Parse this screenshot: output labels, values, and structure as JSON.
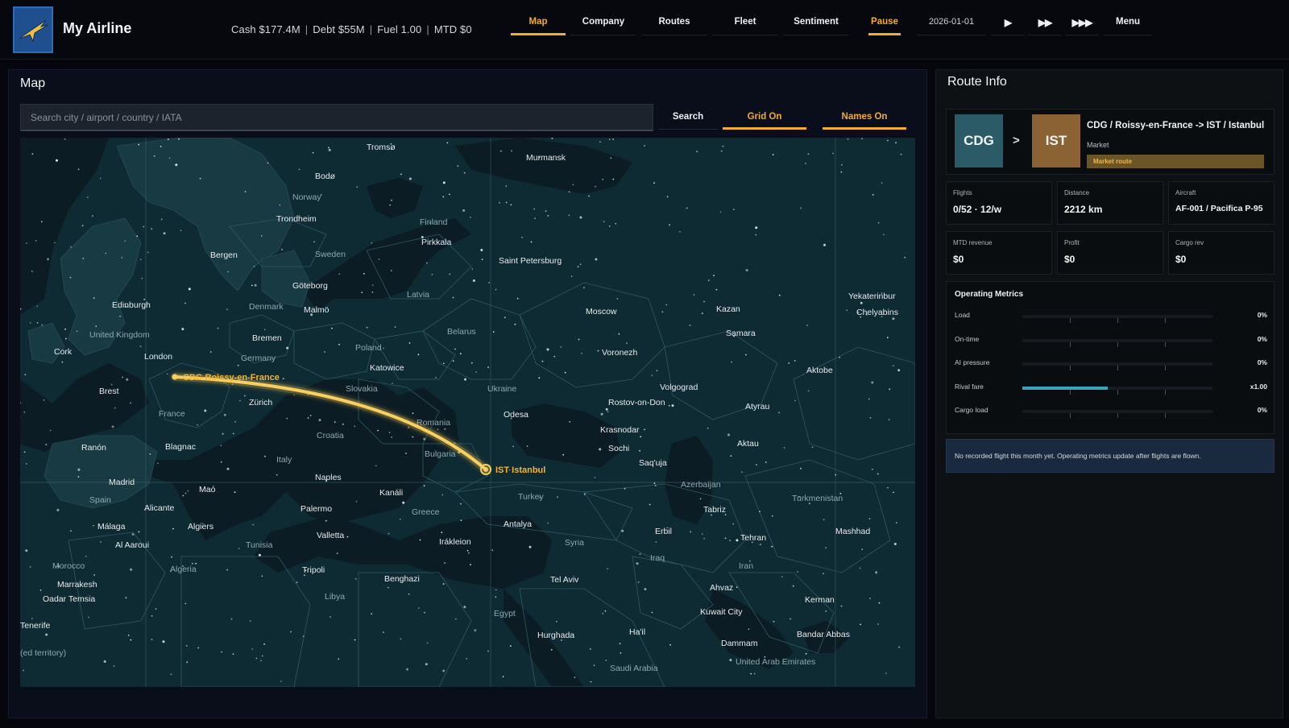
{
  "app": {
    "title": "My Airline",
    "stats": [
      "Cash $177.4M",
      "Debt $55M",
      "Fuel 1.00",
      "MTD $0"
    ]
  },
  "nav": {
    "tabs": [
      "Map",
      "Company",
      "Routes",
      "Fleet",
      "Sentiment",
      "Pause"
    ],
    "date": "2026-01-01",
    "speed": [
      "▶",
      "▶▶",
      "▶▶▶"
    ],
    "menu": "Menu"
  },
  "map": {
    "title": "Map",
    "search_placeholder": "Search city / airport / country / IATA",
    "search_button": "Search",
    "grid_toggle": "Grid On",
    "names_toggle": "Names On",
    "cities": [
      "Tromsø",
      "Murmansk",
      "Bodø",
      "Trondheim",
      "Bergen",
      "Pirkkala",
      "Saint Petersburg",
      "Göteborg",
      "Malmö",
      "Edinburgh",
      "Cork",
      "London",
      "Bremen",
      "Katowice",
      "Moscow",
      "Kazan",
      "Samara",
      "Yekaterinbur",
      "Chelyabins",
      "Voronezh",
      "Aktobe",
      "Volgograd",
      "Rostov-on-Don",
      "Atyrau",
      "Brest",
      "Zürich",
      "Odesa",
      "Krasnodar",
      "Sochi",
      "Aktau",
      "Saq'uja",
      "Ranón",
      "Blagnac",
      "Madrid",
      "Maó",
      "Naples",
      "Kanáli",
      "Alicante",
      "Palermo",
      "Tabriz",
      "Málaga",
      "Algiers",
      "Al Aaroui",
      "Valletta",
      "Antalya",
      "Erbil",
      "Tehran",
      "Mashhad",
      "Irákleion",
      "Marrakesh",
      "Oadar Temsia",
      "Tripoli",
      "Benghazi",
      "Tel Aviv",
      "Ahvaz",
      "Kuwait City",
      "Kerman",
      "Tenerife",
      "Hurghada",
      "Ha'il",
      "Dammam",
      "Bandar Abbas"
    ],
    "countries": [
      "Norway",
      "Finland",
      "Sweden",
      "Denmark",
      "Latvia",
      "United Kingdom",
      "Belarus",
      "Poland",
      "Germany",
      "Ukraine",
      "Slovakia",
      "France",
      "Romania",
      "Croatia",
      "Bulgaria",
      "Italy",
      "Spain",
      "Turkey",
      "Azerbaijan",
      "Turkmenistan",
      "Greece",
      "Syria",
      "Tunisia",
      "Morocco",
      "Algeria",
      "Iraq",
      "Iran",
      "Libya",
      "Egypt",
      "Saudi Arabia",
      "United Arab Emirates",
      "(ed territory)"
    ],
    "route": {
      "origin": "CDG Roissy-en-France",
      "destination": "IST Istanbul"
    }
  },
  "route_info": {
    "title": "Route Info",
    "from": "CDG",
    "to": "IST",
    "arrow": ">",
    "name": "CDG / Roissy-en-France -> IST / Istanbul",
    "type": "Market",
    "badge": "Market route",
    "cards": [
      {
        "label": "Flights",
        "value": "0/52 · 12/w"
      },
      {
        "label": "Distance",
        "value": "2212 km"
      },
      {
        "label": "Aircraft",
        "value": "AF-001 / Pacifica P-95"
      },
      {
        "label": "MTD revenue",
        "value": "$0"
      },
      {
        "label": "Profit",
        "value": "$0"
      },
      {
        "label": "Cargo rev",
        "value": "$0"
      }
    ],
    "metrics_title": "Operating Metrics",
    "metrics": [
      {
        "label": "Load",
        "value": "0%",
        "level": 0
      },
      {
        "label": "On-time",
        "value": "0%",
        "level": 0
      },
      {
        "label": "AI pressure",
        "value": "0%",
        "level": 0
      },
      {
        "label": "Rival fare",
        "value": "x1.00",
        "level": 0.45
      },
      {
        "label": "Cargo load",
        "value": "0%",
        "level": 0
      }
    ],
    "notice": "No recorded flight this month yet. Operating metrics update after flights are flown."
  },
  "colors": {
    "accent": "#f0ad2e",
    "route": "#f2c24a",
    "water": "#0b1c25",
    "land": "#183a42",
    "metric_fill": "#3ba3bd"
  }
}
